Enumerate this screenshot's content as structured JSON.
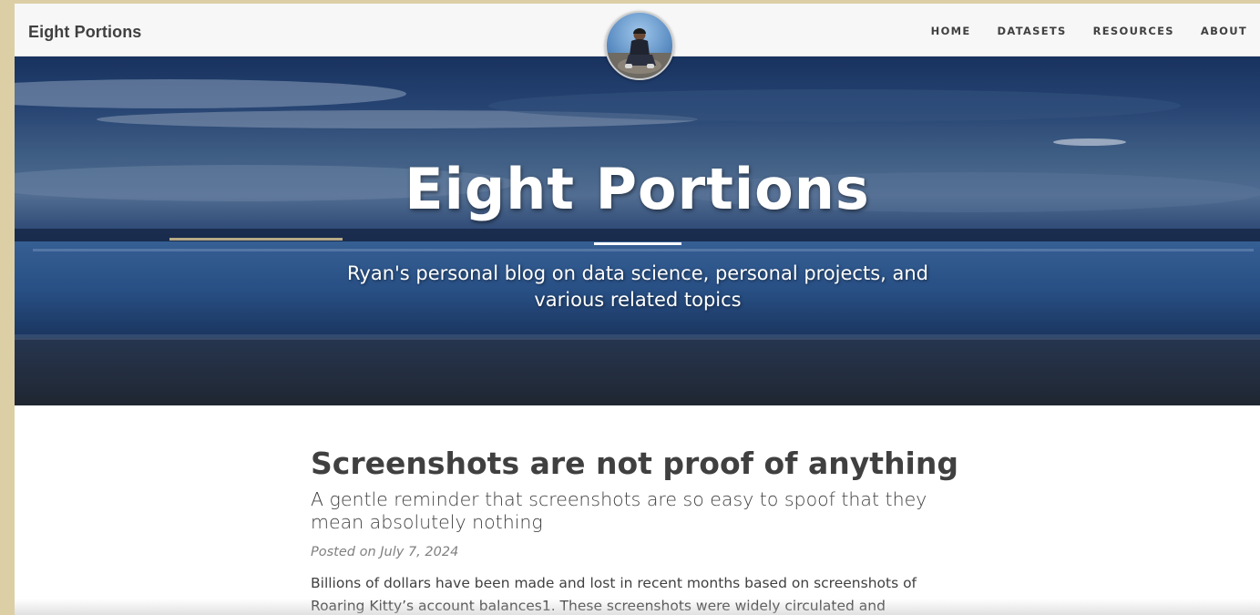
{
  "navbar": {
    "brand": "Eight Portions",
    "links": [
      "HOME",
      "DATASETS",
      "RESOURCES",
      "ABOUT"
    ]
  },
  "hero": {
    "title": "Eight Portions",
    "subtitle": "Ryan's personal blog on data science, personal projects, and various related topics"
  },
  "post": {
    "title": "Screenshots are not proof of anything",
    "subtitle": "A gentle reminder that screenshots are so easy to spoof that they mean absolutely nothing",
    "meta": "Posted on July 7, 2024",
    "body": "Billions of dollars have been made and lost in recent months based on screenshots of Roaring Kitty’s account balances1. These screenshots were widely circulated and"
  },
  "colors": {
    "page_border": "#dccfa6",
    "navbar_bg": "#f7f7f7",
    "text": "#404040",
    "meta": "#808080"
  }
}
